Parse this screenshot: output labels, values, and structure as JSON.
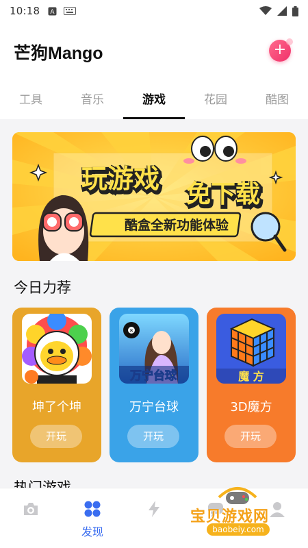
{
  "status_bar": {
    "time": "10:18"
  },
  "header": {
    "app_title": "芒狗Mango",
    "add_icon": "plus-icon",
    "accent": "#f0306a"
  },
  "tabs": [
    {
      "label": "工具",
      "active": false
    },
    {
      "label": "音乐",
      "active": false
    },
    {
      "label": "游戏",
      "active": true
    },
    {
      "label": "花园",
      "active": false
    },
    {
      "label": "酷图",
      "active": false
    }
  ],
  "banner": {
    "headline_1": "玩游戏",
    "headline_2": "免下载",
    "subline": "酷盒全新功能体验",
    "background": "#ffc928"
  },
  "today_section": {
    "title": "今日力荐"
  },
  "games": [
    {
      "name": "坤了个坤",
      "button": "开玩",
      "color": "#e8a52a",
      "thumb_icon": "chick-character-icon"
    },
    {
      "name": "万宁台球",
      "button": "开玩",
      "color": "#3aa3e8",
      "thumb_icon": "billiards-girl-icon",
      "thumb_caption": "万宁台球"
    },
    {
      "name": "3D魔方",
      "button": "开玩",
      "color": "#f77b2b",
      "thumb_icon": "rubiks-cube-icon",
      "thumb_caption": "魔 方"
    }
  ],
  "hot_section": {
    "title": "热门游戏"
  },
  "bottom_nav": [
    {
      "label": "",
      "icon": "camera-icon",
      "active": false
    },
    {
      "label": "发现",
      "icon": "grid-icon",
      "active": true,
      "color": "#3a6df0"
    },
    {
      "label": "",
      "icon": "lightning-icon",
      "active": false
    },
    {
      "label": "",
      "icon": "chat-icon",
      "active": false
    },
    {
      "label": "",
      "icon": "profile-icon",
      "active": false
    }
  ],
  "watermark": {
    "text": "宝贝游戏网",
    "url": "baobeiy.com"
  }
}
